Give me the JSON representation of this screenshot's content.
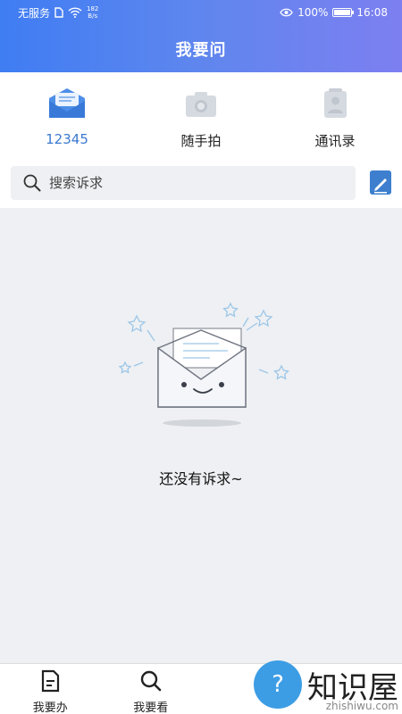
{
  "status_bar": {
    "carrier": "无服务",
    "network_speed_value": "182",
    "network_speed_unit": "B/s",
    "battery": "100%",
    "time": "16:08"
  },
  "header": {
    "title": "我要问"
  },
  "tabs": [
    {
      "label": "12345",
      "icon": "mail-icon",
      "active": true
    },
    {
      "label": "随手拍",
      "icon": "camera-icon",
      "active": false
    },
    {
      "label": "通讯录",
      "icon": "contacts-icon",
      "active": false
    }
  ],
  "search": {
    "placeholder": "搜索诉求"
  },
  "empty_state": {
    "message": "还没有诉求~"
  },
  "bottom_nav": [
    {
      "label": "我要办",
      "icon": "document-icon"
    },
    {
      "label": "我要看",
      "icon": "search-icon"
    }
  ],
  "watermark": {
    "brand": "知识屋",
    "url": "zhishiwu.com"
  },
  "colors": {
    "header_start": "#3f7df3",
    "header_end": "#7d7ff0",
    "active_tab": "#3b79cf",
    "accent": "#3d7fce"
  }
}
